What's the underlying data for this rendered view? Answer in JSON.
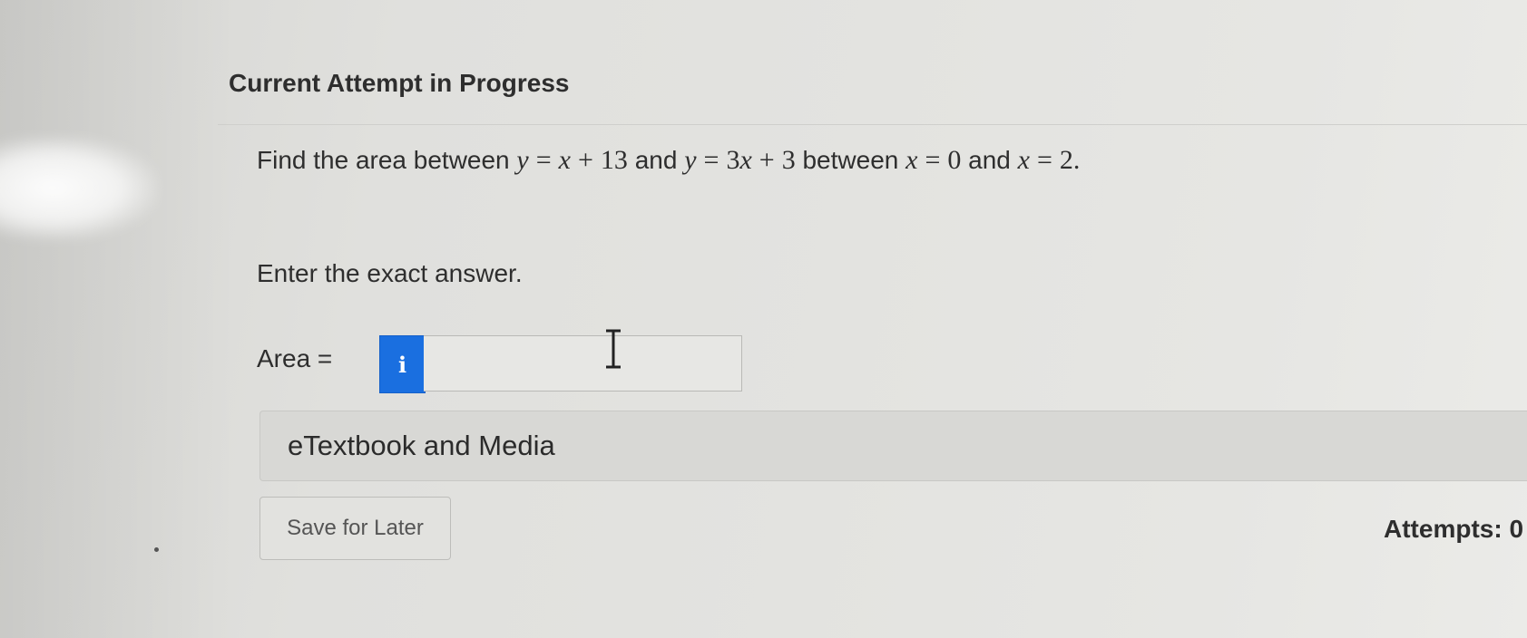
{
  "page": {
    "heading": "Current Attempt in Progress",
    "question": {
      "prefix": "Find the area between ",
      "eq1_var": "y",
      "eq1_eq": "=",
      "eq1_rhs_x": "x",
      "eq1_plus": "+",
      "eq1_const": "13",
      "and1": " and ",
      "eq2_var": "y",
      "eq2_eq": "=",
      "eq2_rhs_coef": "3",
      "eq2_rhs_x": "x",
      "eq2_plus": "+",
      "eq2_const": "3",
      "between": " between ",
      "b1_var": "x",
      "b1_eq": "=",
      "b1_val": "0",
      "and2": " and ",
      "b2_var": "x",
      "b2_eq": "=",
      "b2_val": "2",
      "end": "."
    },
    "instruction": "Enter the exact answer.",
    "answer": {
      "label": "Area =",
      "info_glyph": "i",
      "value": ""
    },
    "media_label": "eTextbook and Media",
    "save_label": "Save for Later",
    "attempts_label": "Attempts: 0"
  },
  "colors": {
    "info_button": "#1a6fe0",
    "background": "#e2e2df",
    "text": "#2e2e2e"
  },
  "icons": {
    "info": "info-icon",
    "cursor": "text-cursor-icon"
  }
}
